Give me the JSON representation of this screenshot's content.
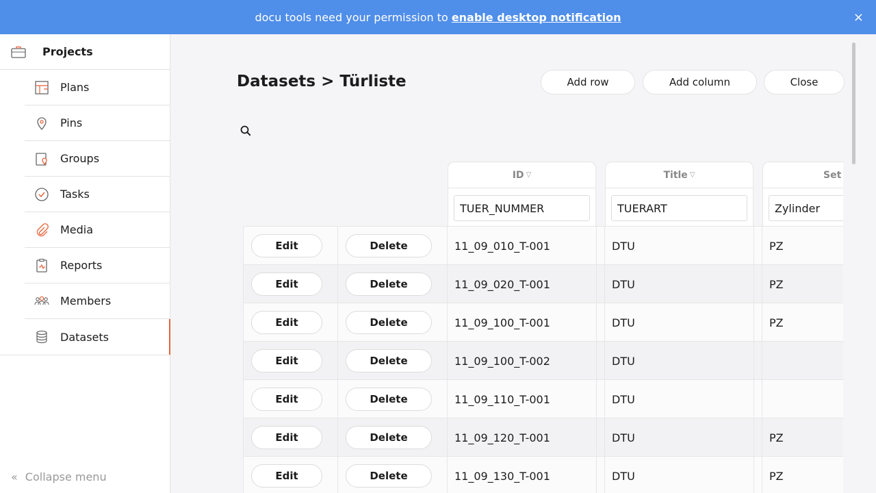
{
  "banner": {
    "text": "docu tools need your permission to",
    "link": "enable desktop notification",
    "close": "×"
  },
  "sidebar": {
    "project": "Projects",
    "items": [
      {
        "label": "Plans",
        "icon": "plans-icon"
      },
      {
        "label": "Pins",
        "icon": "pin-icon"
      },
      {
        "label": "Groups",
        "icon": "groups-icon"
      },
      {
        "label": "Tasks",
        "icon": "tasks-icon"
      },
      {
        "label": "Media",
        "icon": "paperclip-icon"
      },
      {
        "label": "Reports",
        "icon": "reports-icon"
      },
      {
        "label": "Members",
        "icon": "members-icon"
      },
      {
        "label": "Datasets",
        "icon": "database-icon"
      }
    ],
    "collapse": "Collapse menu"
  },
  "header": {
    "title": "Datasets > Türliste",
    "add_row": "Add row",
    "add_column": "Add column",
    "close": "Close"
  },
  "table": {
    "columns": [
      {
        "label": "ID",
        "filter": "TUER_NUMMER"
      },
      {
        "label": "Title",
        "filter": "TUERART"
      },
      {
        "label": "Set",
        "filter": "Zylinder"
      }
    ],
    "edit_label": "Edit",
    "delete_label": "Delete",
    "rows": [
      {
        "id": "11_09_010_T-001",
        "title": "DTU",
        "set": "PZ"
      },
      {
        "id": "11_09_020_T-001",
        "title": "DTU",
        "set": "PZ"
      },
      {
        "id": "11_09_100_T-001",
        "title": "DTU",
        "set": "PZ"
      },
      {
        "id": "11_09_100_T-002",
        "title": "DTU",
        "set": ""
      },
      {
        "id": "11_09_110_T-001",
        "title": "DTU",
        "set": ""
      },
      {
        "id": "11_09_120_T-001",
        "title": "DTU",
        "set": "PZ"
      },
      {
        "id": "11_09_130_T-001",
        "title": "DTU",
        "set": "PZ"
      }
    ]
  },
  "colors": {
    "banner": "#4f8ee9",
    "accent": "#e8623a"
  }
}
